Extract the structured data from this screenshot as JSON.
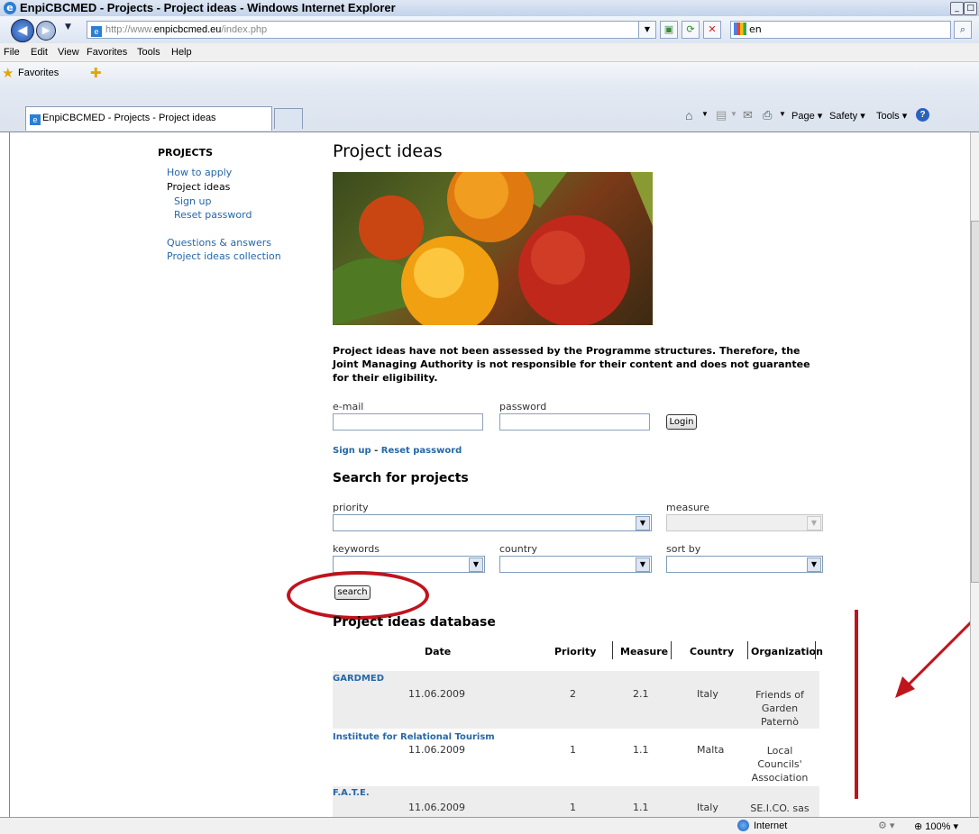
{
  "window": {
    "title": "EnpiCBCMED - Projects - Project ideas - Windows Internet Explorer"
  },
  "address": {
    "url_prefix": "http://www.",
    "url_domain": "enpicbcmed.eu",
    "url_path": "/index.php"
  },
  "search_provider": {
    "value": "en"
  },
  "menu": [
    "File",
    "Edit",
    "View",
    "Favorites",
    "Tools",
    "Help"
  ],
  "favorites_label": "Favorites",
  "tab": {
    "label": "EnpiCBCMED - Projects - Project ideas"
  },
  "commands": {
    "page": "Page",
    "safety": "Safety",
    "tools": "Tools"
  },
  "sidebar": {
    "heading": "PROJECTS",
    "items": [
      {
        "label": "How to apply"
      },
      {
        "label": "Project ideas"
      },
      {
        "label": "Sign up"
      },
      {
        "label": "Reset password"
      },
      {
        "label": "Questions & answers"
      },
      {
        "label": "Project ideas collection"
      }
    ]
  },
  "main": {
    "title": "Project ideas",
    "disclaimer": "Project ideas have not been assessed by the Programme structures. Therefore, the Joint Managing Authority is not responsible for their content and does not guarantee for their eligibility.",
    "login": {
      "email_label": "e-mail",
      "password_label": "password",
      "button": "Login",
      "signup": "Sign up",
      "separator": "-",
      "reset": "Reset password"
    },
    "search": {
      "heading": "Search for projects",
      "priority_label": "priority",
      "measure_label": "measure",
      "keywords_label": "keywords",
      "country_label": "country",
      "sortby_label": "sort by",
      "button": "search"
    },
    "database": {
      "heading": "Project ideas database",
      "columns": [
        "Date",
        "Priority",
        "Measure",
        "Country",
        "Organization"
      ],
      "rows": [
        {
          "name": "GARDMED",
          "date": "11.06.2009",
          "priority": "2",
          "measure": "2.1",
          "country": "Italy",
          "org": [
            "Friends of",
            "Garden",
            "Paternò"
          ]
        },
        {
          "name": "Instiitute for Relational Tourism",
          "date": "11.06.2009",
          "priority": "1",
          "measure": "1.1",
          "country": "Malta",
          "org": [
            "Local",
            "Councils'",
            "Association"
          ]
        },
        {
          "name": "F.A.T.E.",
          "date": "11.06.2009",
          "priority": "1",
          "measure": "1.1",
          "country": "Italy",
          "org": [
            "SE.I.CO. sas"
          ]
        }
      ]
    }
  },
  "status": {
    "zone": "Internet",
    "zoom": "100%"
  },
  "colors": {
    "annotation": "#c0141c",
    "link": "#2667a8"
  }
}
